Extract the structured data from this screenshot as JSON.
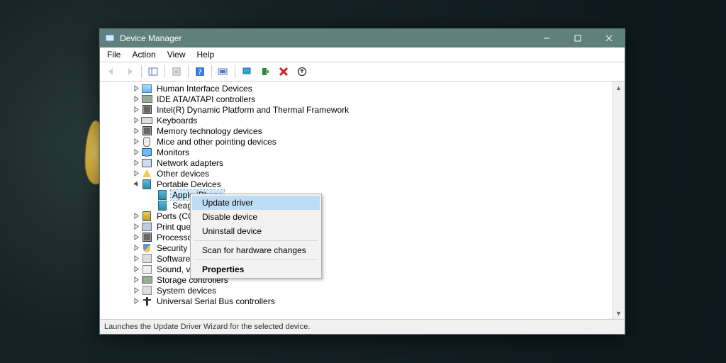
{
  "window": {
    "title": "Device Manager"
  },
  "menubar": {
    "items": [
      "File",
      "Action",
      "View",
      "Help"
    ]
  },
  "tree": {
    "items": [
      {
        "label": "Human Interface Devices",
        "icon": "hid",
        "level": 1,
        "exp": "col"
      },
      {
        "label": "IDE ATA/ATAPI controllers",
        "icon": "drive",
        "level": 1,
        "exp": "col"
      },
      {
        "label": "Intel(R) Dynamic Platform and Thermal Framework",
        "icon": "chip",
        "level": 1,
        "exp": "col"
      },
      {
        "label": "Keyboards",
        "icon": "kb",
        "level": 1,
        "exp": "col"
      },
      {
        "label": "Memory technology devices",
        "icon": "chip",
        "level": 1,
        "exp": "col"
      },
      {
        "label": "Mice and other pointing devices",
        "icon": "mouse",
        "level": 1,
        "exp": "col"
      },
      {
        "label": "Monitors",
        "icon": "mon",
        "level": 1,
        "exp": "col"
      },
      {
        "label": "Network adapters",
        "icon": "net",
        "level": 1,
        "exp": "col"
      },
      {
        "label": "Other devices",
        "icon": "warn",
        "level": 1,
        "exp": "col"
      },
      {
        "label": "Portable Devices",
        "icon": "port",
        "level": 1,
        "exp": "exp"
      },
      {
        "label": "Apple iPhone",
        "icon": "port",
        "level": 2,
        "exp": "none",
        "selected": true
      },
      {
        "label": "Seagate E",
        "icon": "port",
        "level": 2,
        "exp": "none",
        "truncated": true
      },
      {
        "label": "Ports (COM &",
        "icon": "ports",
        "level": 1,
        "exp": "col",
        "truncated": true
      },
      {
        "label": "Print queues",
        "icon": "printer",
        "level": 1,
        "exp": "col"
      },
      {
        "label": "Processors",
        "icon": "chip",
        "level": 1,
        "exp": "col"
      },
      {
        "label": "Security devic",
        "icon": "shield",
        "level": 1,
        "exp": "col",
        "truncated": true
      },
      {
        "label": "Software devi",
        "icon": "sys",
        "level": 1,
        "exp": "col",
        "truncated": true
      },
      {
        "label": "Sound, video",
        "icon": "snd",
        "level": 1,
        "exp": "col",
        "truncated": true
      },
      {
        "label": "Storage controllers",
        "icon": "drive",
        "level": 1,
        "exp": "col"
      },
      {
        "label": "System devices",
        "icon": "sys",
        "level": 1,
        "exp": "col"
      },
      {
        "label": "Universal Serial Bus controllers",
        "icon": "usb",
        "level": 1,
        "exp": "col"
      }
    ]
  },
  "context_menu": {
    "items": [
      {
        "label": "Update driver",
        "style": "highlight"
      },
      {
        "label": "Disable device",
        "style": ""
      },
      {
        "label": "Uninstall device",
        "style": ""
      },
      {
        "label": "",
        "style": "sep"
      },
      {
        "label": "Scan for hardware changes",
        "style": ""
      },
      {
        "label": "",
        "style": "sep"
      },
      {
        "label": "Properties",
        "style": "bold"
      }
    ]
  },
  "statusbar": {
    "text": "Launches the Update Driver Wizard for the selected device."
  }
}
